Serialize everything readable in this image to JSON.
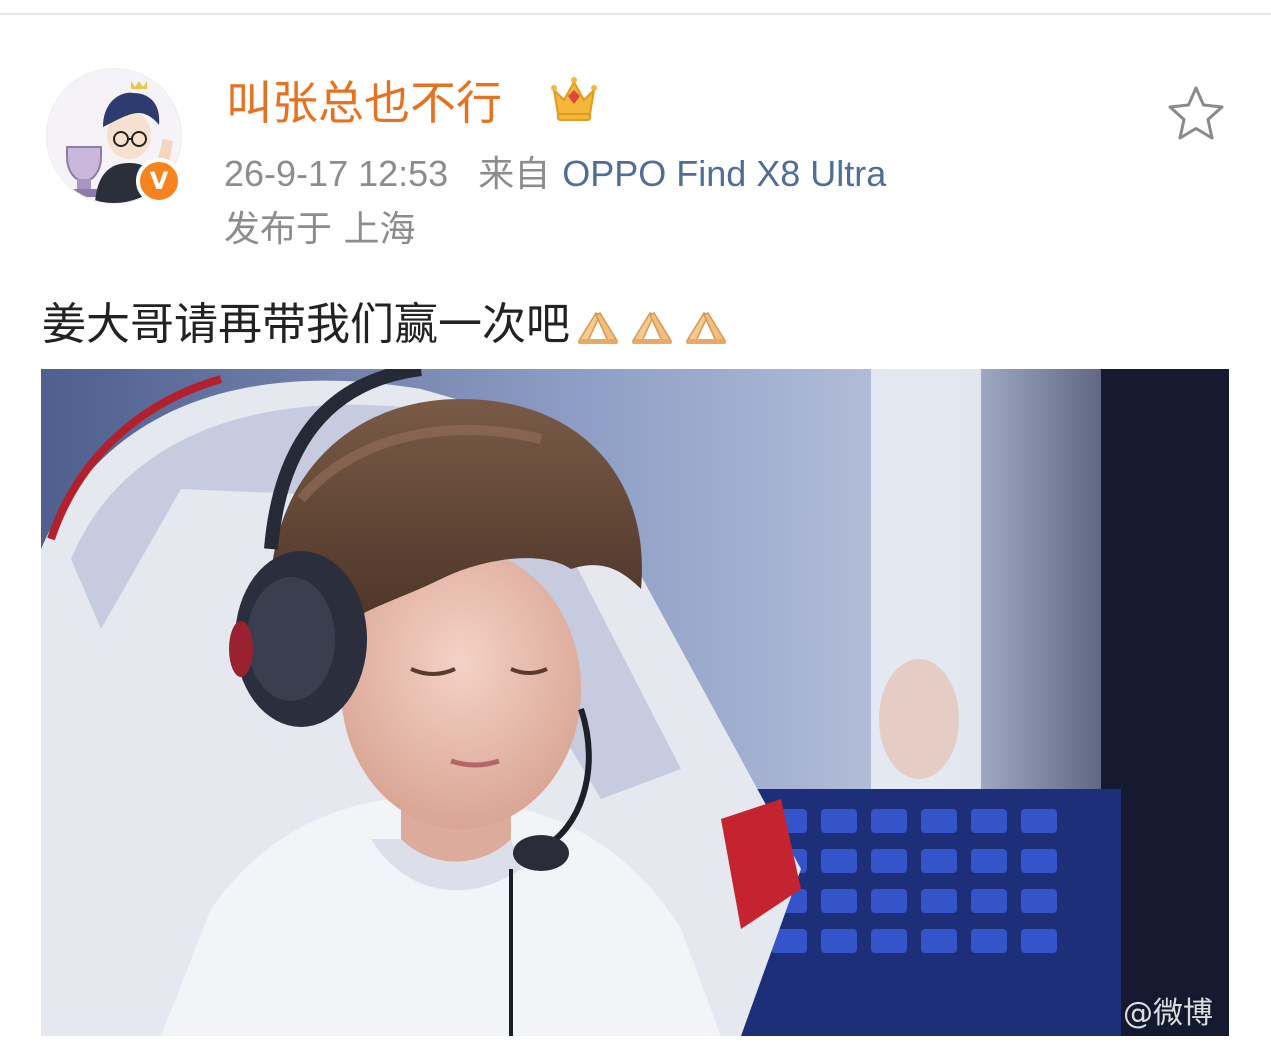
{
  "post": {
    "author": {
      "name": "叫张总也不行",
      "verified_badge": "V",
      "crown_icon": "crown-icon",
      "avatar_icon": "avatar-cartoon"
    },
    "meta": {
      "time": "26-9-17 12:53",
      "from_label": "来自",
      "device": "OPPO Find X8 Ultra",
      "location": "发布于 上海"
    },
    "text": "姜大哥请再带我们赢一次吧",
    "emojis": [
      "pray-icon",
      "pray-icon",
      "pray-icon"
    ],
    "image": {
      "description_icon": "photo-esports-player",
      "watermark": "@微博"
    },
    "favorite_icon": "star-outline-icon"
  },
  "colors": {
    "username": "#e8711f",
    "device_link": "#4f6e97",
    "meta_gray": "#8c8c8c",
    "badge": "#f7831e"
  }
}
